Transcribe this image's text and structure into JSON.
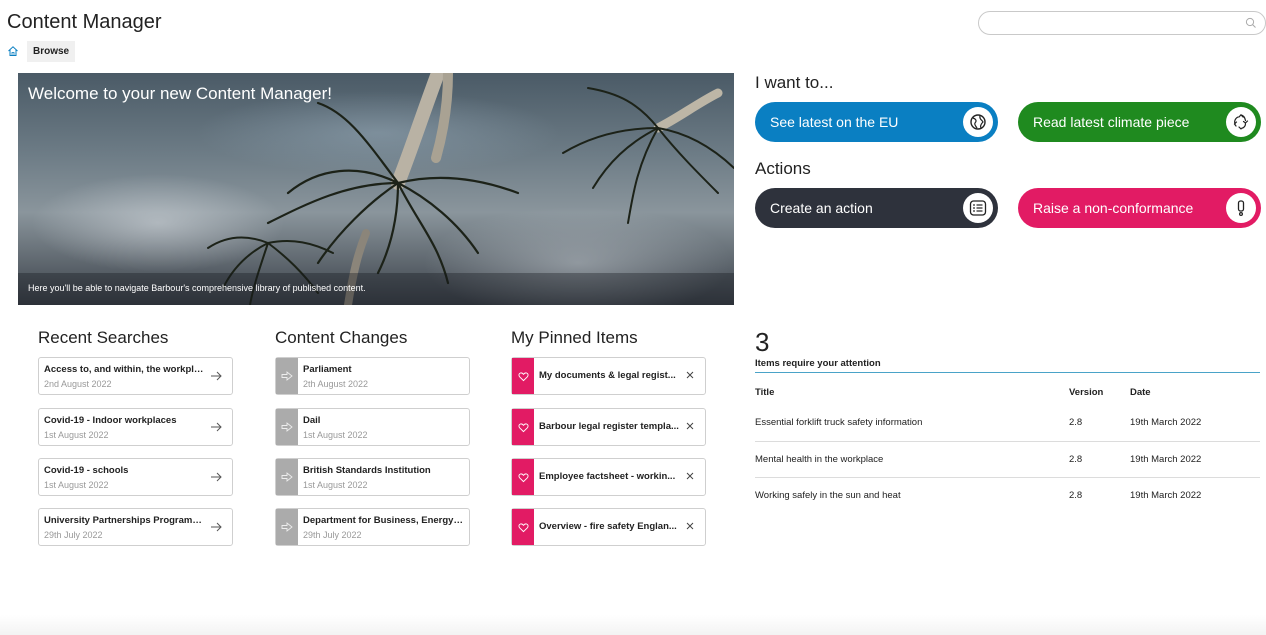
{
  "app": {
    "title": "Content Manager"
  },
  "search": {
    "placeholder": "",
    "value": ""
  },
  "breadcrumb": {
    "items": [
      "Browse"
    ]
  },
  "hero": {
    "title": "Welcome to your new Content Manager!",
    "subtitle": "Here you'll be able to navigate Barbour's comprehensive library of published content."
  },
  "want": {
    "title": "I want to...",
    "buttons": [
      {
        "label": "See latest on the EU",
        "icon": "globe-icon",
        "color": "#0a7fc2"
      },
      {
        "label": "Read latest climate piece",
        "icon": "recycle-icon",
        "color": "#1f8a1f"
      }
    ]
  },
  "actions": {
    "title": "Actions",
    "buttons": [
      {
        "label": "Create an action",
        "icon": "list-icon",
        "color": "#2e323c"
      },
      {
        "label": "Raise a non-conformance",
        "icon": "exclamation-icon",
        "color": "#e21b64"
      }
    ]
  },
  "recent_searches": {
    "title": "Recent Searches",
    "items": [
      {
        "title": "Access to, and within, the workplace",
        "date": "2nd August 2022"
      },
      {
        "title": "Covid-19 - Indoor workplaces",
        "date": "1st August 2022"
      },
      {
        "title": "Covid-19 - schools",
        "date": "1st August 2022"
      },
      {
        "title": "University Partnerships Programm...",
        "date": "29th July 2022"
      }
    ]
  },
  "content_changes": {
    "title": "Content Changes",
    "items": [
      {
        "title": "Parliament",
        "date": "2th August 2022"
      },
      {
        "title": "Dail",
        "date": "1st August 2022"
      },
      {
        "title": "British Standards Institution",
        "date": "1st August 2022"
      },
      {
        "title": "Department for Business, Energy ...",
        "date": "29th July 2022"
      }
    ]
  },
  "pinned": {
    "title": "My Pinned Items",
    "items": [
      {
        "title": "My documents & legal regist..."
      },
      {
        "title": "Barbour legal register templa..."
      },
      {
        "title": "Employee factsheet - workin..."
      },
      {
        "title": "Overview - fire safety Englan..."
      }
    ]
  },
  "attention": {
    "count": "3",
    "label": "Items require your attention",
    "headers": {
      "title": "Title",
      "version": "Version",
      "date": "Date"
    },
    "rows": [
      {
        "title": "Essential forklift truck safety information",
        "version": "2.8",
        "date": "19th March 2022"
      },
      {
        "title": "Mental health in the workplace",
        "version": "2.8",
        "date": "19th March 2022"
      },
      {
        "title": "Working safely in the sun and heat",
        "version": "2.8",
        "date": "19th March 2022"
      }
    ]
  }
}
